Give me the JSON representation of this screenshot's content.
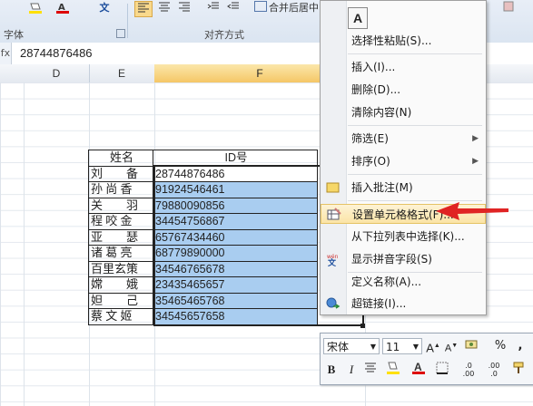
{
  "ribbon": {
    "font_group_label": "字体",
    "align_group_label": "对齐方式",
    "merge_label": "合并后居中",
    "wen_label": "文"
  },
  "formula_bar": {
    "fx": "fx",
    "value": "28744876486"
  },
  "columns": [
    "D",
    "E",
    "F"
  ],
  "table": {
    "headers": [
      "姓名",
      "ID号"
    ],
    "rows": [
      {
        "name": "刘　　备",
        "id": "28744876486"
      },
      {
        "name": "孙 尚 香",
        "id": "91924546461"
      },
      {
        "name": "关　　羽",
        "id": "79880090856"
      },
      {
        "name": "程 咬 金",
        "id": "34454756867"
      },
      {
        "name": "亚　　瑟",
        "id": "65767434460"
      },
      {
        "name": "诸 葛 亮",
        "id": "68779890000"
      },
      {
        "name": "百里玄策",
        "id": "34546765678"
      },
      {
        "name": "嫦　　娥",
        "id": "23435465657"
      },
      {
        "name": "妲　　己",
        "id": "35465465768"
      },
      {
        "name": "蔡 文 姬",
        "id": "34545657658"
      }
    ]
  },
  "context_menu": {
    "paste_icon_letter": "A",
    "items": [
      {
        "label": "选择性粘贴(S)...",
        "icon": "paste-special"
      },
      {
        "label": "插入(I)...",
        "icon": ""
      },
      {
        "label": "删除(D)...",
        "icon": ""
      },
      {
        "label": "清除内容(N)",
        "icon": ""
      },
      {
        "label": "筛选(E)",
        "icon": "",
        "submenu": true
      },
      {
        "label": "排序(O)",
        "icon": "",
        "submenu": true
      },
      {
        "label": "插入批注(M)",
        "icon": "comment-icon"
      },
      {
        "label": "设置单元格格式(F)...",
        "icon": "format-cells-icon",
        "highlighted": true
      },
      {
        "label": "从下拉列表中选择(K)...",
        "icon": ""
      },
      {
        "label": "显示拼音字段(S)",
        "icon": "phonetic-icon"
      },
      {
        "label": "定义名称(A)...",
        "icon": ""
      },
      {
        "label": "超链接(I)...",
        "icon": "hyperlink-icon"
      }
    ]
  },
  "mini_toolbar": {
    "font": "宋体",
    "size": "11",
    "bold": "B",
    "italic": "I",
    "percent": "%",
    "comma": ","
  },
  "colors": {
    "selection_fill": "#a9cdf0",
    "arrow": "#e02424",
    "highlight": "#fbe4a6"
  }
}
